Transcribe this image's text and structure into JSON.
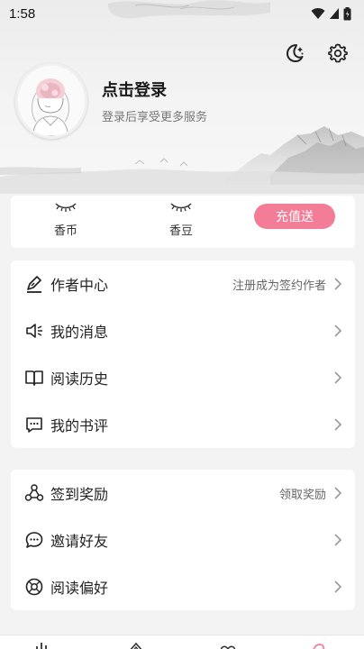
{
  "status_bar": {
    "time": "1:58"
  },
  "header": {
    "login_title": "点击登录",
    "login_subtitle": "登录后享受更多服务"
  },
  "wallet": {
    "items": [
      {
        "label": "香币",
        "value_icon": "closed-eye-icon"
      },
      {
        "label": "香豆",
        "value_icon": "closed-eye-icon"
      }
    ],
    "recharge_label": "充值送",
    "accent": "#f37d97"
  },
  "menu_group_1": [
    {
      "label": "作者中心",
      "hint": "注册成为签约作者",
      "icon": "pen-icon"
    },
    {
      "label": "我的消息",
      "hint": "",
      "icon": "speaker-icon"
    },
    {
      "label": "阅读历史",
      "hint": "",
      "icon": "book-icon"
    },
    {
      "label": "我的书评",
      "hint": "",
      "icon": "comment-icon"
    }
  ],
  "menu_group_2": [
    {
      "label": "签到奖励",
      "hint": "领取奖励",
      "icon": "triangle-circles-icon"
    },
    {
      "label": "邀请好友",
      "hint": "",
      "icon": "chat-bubbles-icon"
    },
    {
      "label": "阅读偏好",
      "hint": "",
      "icon": "preference-icon"
    }
  ]
}
